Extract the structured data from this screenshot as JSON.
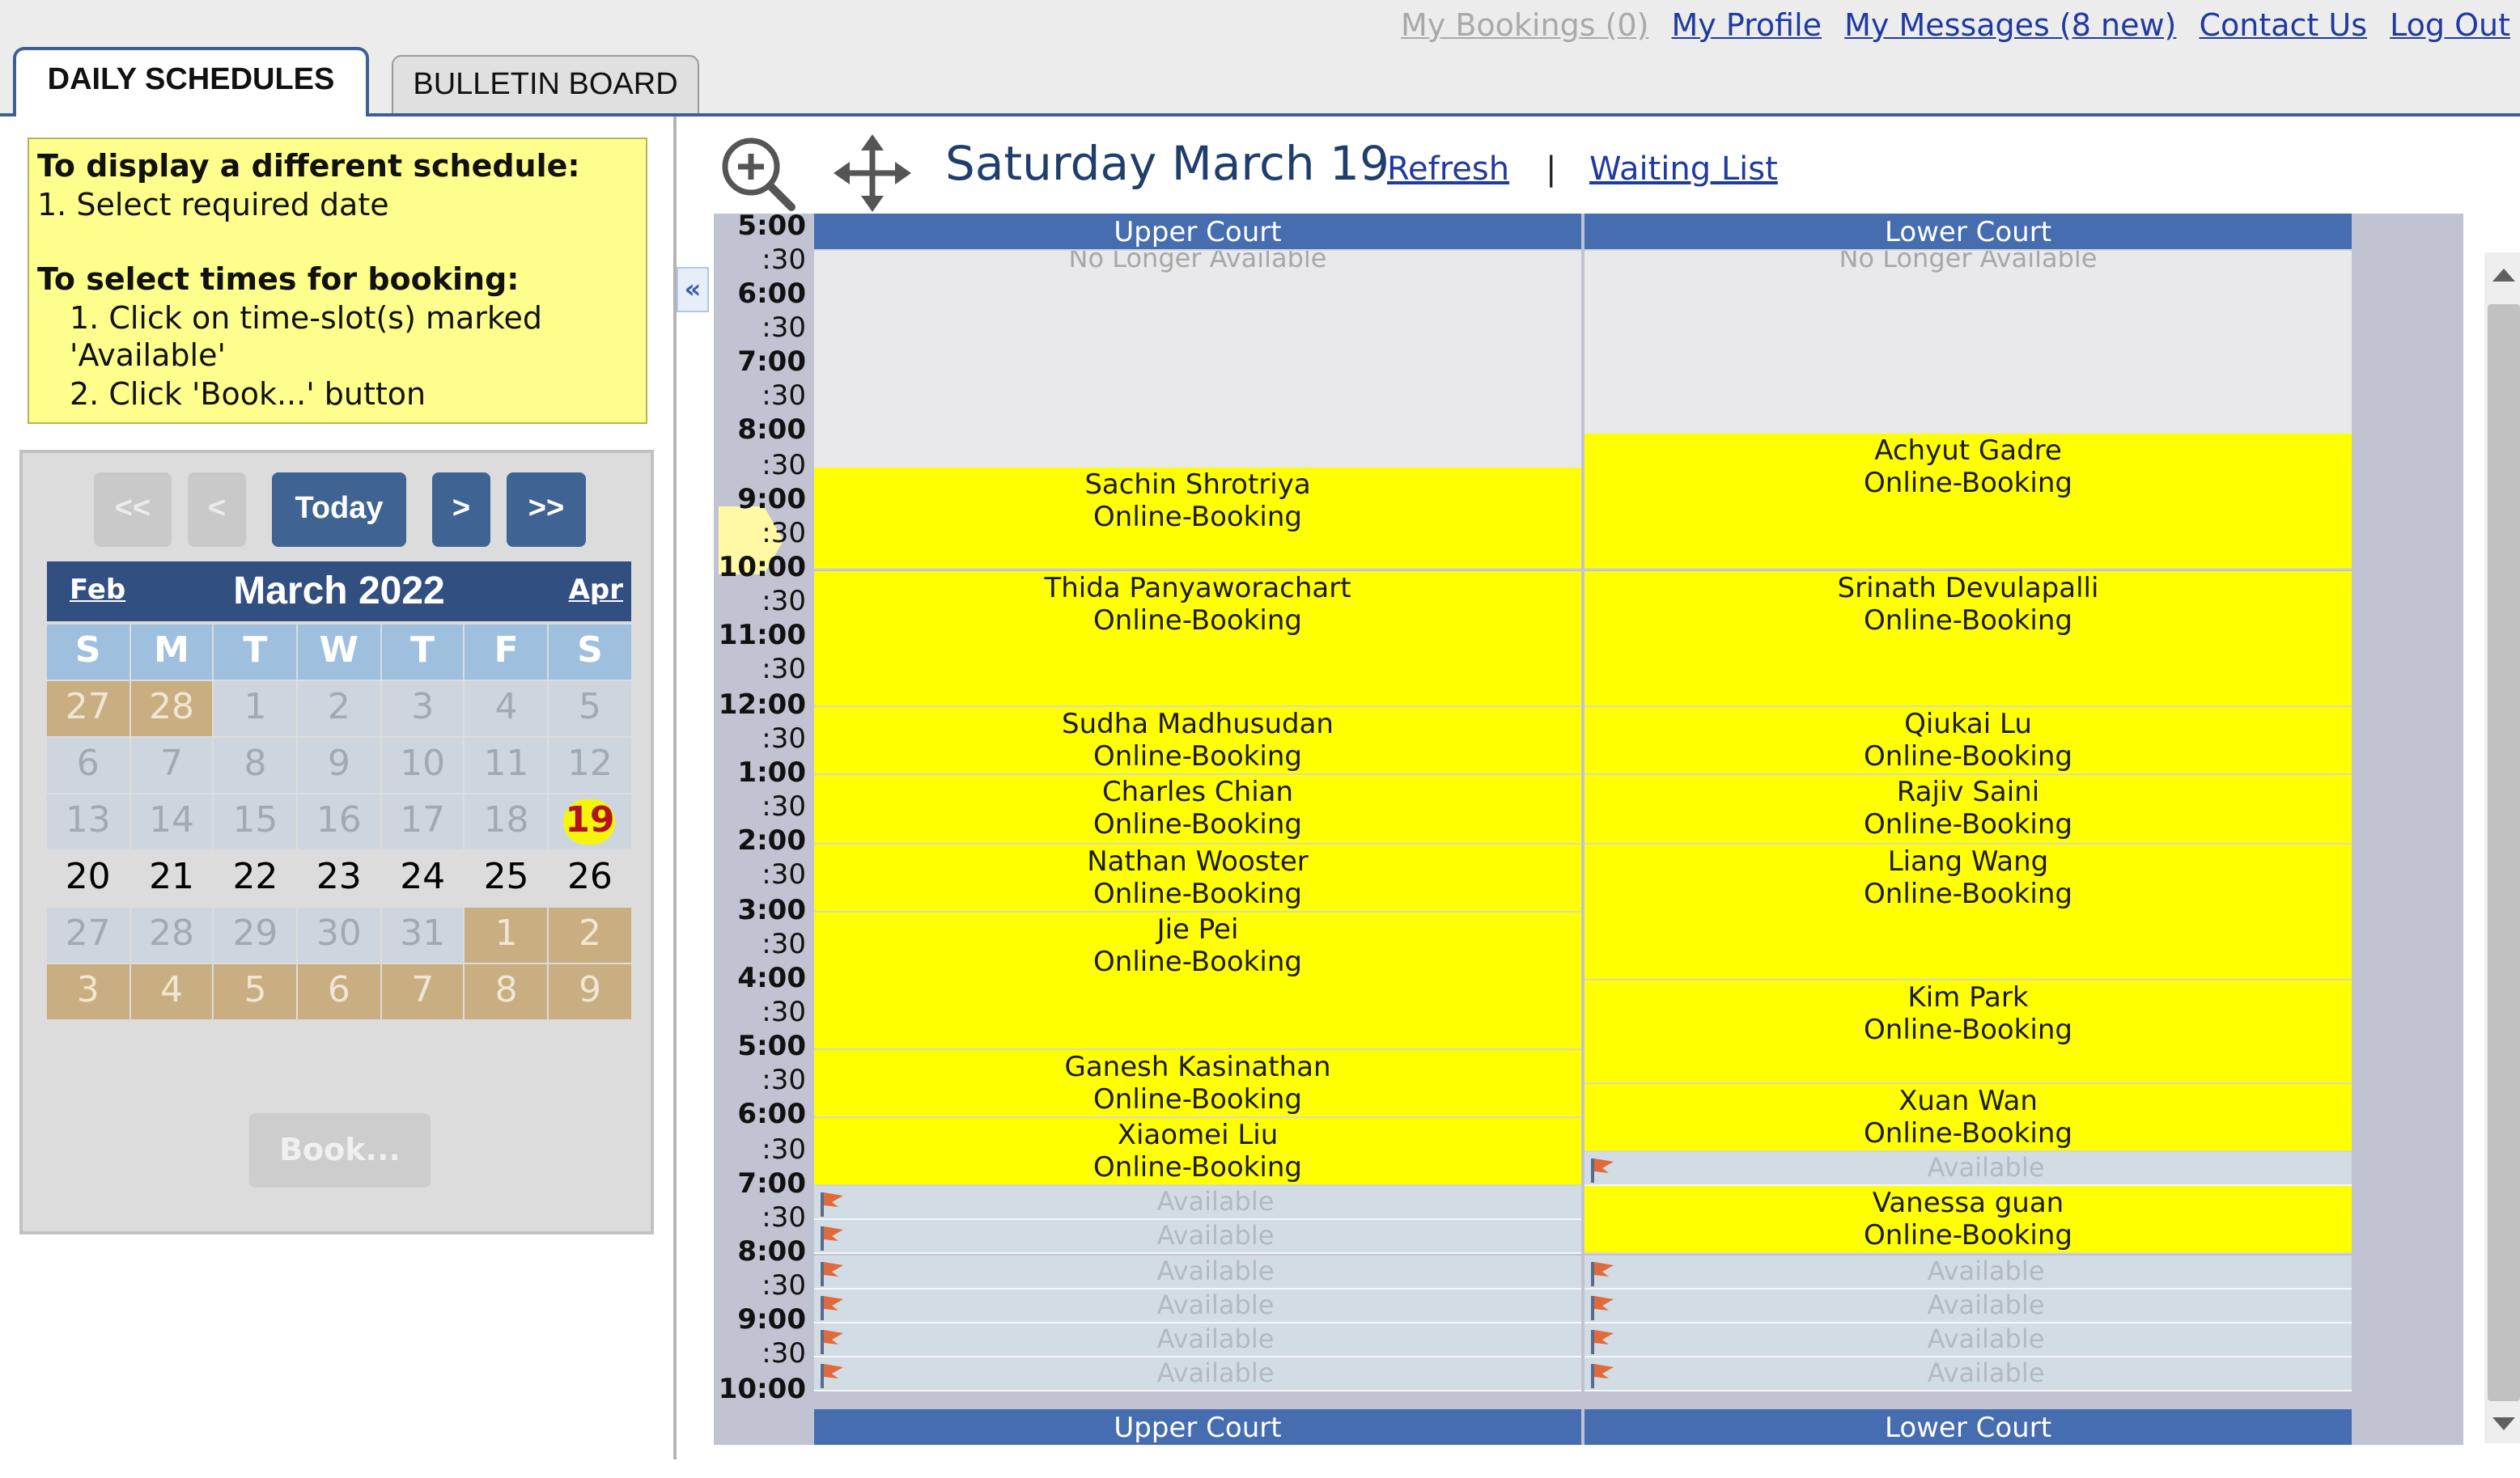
{
  "header": {
    "links": [
      {
        "label": "My Bookings (0)",
        "enabled": false
      },
      {
        "label": "My Profile",
        "enabled": true
      },
      {
        "label": "My Messages (8 new)",
        "enabled": true
      },
      {
        "label": "Contact Us",
        "enabled": true
      },
      {
        "label": "Log Out",
        "enabled": true
      }
    ],
    "tabs": [
      {
        "label": "DAILY SCHEDULES",
        "active": true
      },
      {
        "label": "BULLETIN BOARD",
        "active": false
      }
    ]
  },
  "instructions": {
    "title1": "To display a different schedule:",
    "line1": "1. Select required date",
    "title2": "To select times for booking:",
    "line2": "1. Click on time-slot(s) marked 'Available'",
    "line3": "2. Click 'Book...' button"
  },
  "calendar": {
    "nav": {
      "first": "<<",
      "prev": "<",
      "today": "Today",
      "next": ">",
      "last": ">>"
    },
    "prev_month": "Feb",
    "month_label": "March 2022",
    "next_month": "Apr",
    "weekdays": [
      "S",
      "M",
      "T",
      "W",
      "T",
      "F",
      "S"
    ],
    "weeks": [
      [
        {
          "d": "27",
          "s": "out"
        },
        {
          "d": "28",
          "s": "out"
        },
        {
          "d": "1",
          "s": "past"
        },
        {
          "d": "2",
          "s": "past"
        },
        {
          "d": "3",
          "s": "past"
        },
        {
          "d": "4",
          "s": "past"
        },
        {
          "d": "5",
          "s": "past"
        }
      ],
      [
        {
          "d": "6",
          "s": "past"
        },
        {
          "d": "7",
          "s": "past"
        },
        {
          "d": "8",
          "s": "past"
        },
        {
          "d": "9",
          "s": "past"
        },
        {
          "d": "10",
          "s": "past"
        },
        {
          "d": "11",
          "s": "past"
        },
        {
          "d": "12",
          "s": "past"
        }
      ],
      [
        {
          "d": "13",
          "s": "past"
        },
        {
          "d": "14",
          "s": "past"
        },
        {
          "d": "15",
          "s": "past"
        },
        {
          "d": "16",
          "s": "past"
        },
        {
          "d": "17",
          "s": "past"
        },
        {
          "d": "18",
          "s": "past"
        },
        {
          "d": "19",
          "s": "today"
        }
      ],
      [
        {
          "d": "20",
          "s": "fut"
        },
        {
          "d": "21",
          "s": "fut"
        },
        {
          "d": "22",
          "s": "fut"
        },
        {
          "d": "23",
          "s": "fut"
        },
        {
          "d": "24",
          "s": "fut"
        },
        {
          "d": "25",
          "s": "fut"
        },
        {
          "d": "26",
          "s": "fut"
        }
      ],
      [
        {
          "d": "27",
          "s": "past"
        },
        {
          "d": "28",
          "s": "past"
        },
        {
          "d": "29",
          "s": "past"
        },
        {
          "d": "30",
          "s": "past"
        },
        {
          "d": "31",
          "s": "past"
        },
        {
          "d": "1",
          "s": "out"
        },
        {
          "d": "2",
          "s": "out"
        }
      ],
      [
        {
          "d": "3",
          "s": "out"
        },
        {
          "d": "4",
          "s": "out"
        },
        {
          "d": "5",
          "s": "out"
        },
        {
          "d": "6",
          "s": "out"
        },
        {
          "d": "7",
          "s": "out"
        },
        {
          "d": "8",
          "s": "out"
        },
        {
          "d": "9",
          "s": "out"
        }
      ]
    ],
    "book_label": "Book...",
    "colors": {
      "today_highlight": "#f5f50a",
      "today_text": "#b4121a",
      "nav_enabled": "#3f6494",
      "header": "#324f82"
    }
  },
  "schedule": {
    "day_title": "Saturday March 19",
    "refresh_label": "Refresh",
    "separator": "|",
    "waiting_list_label": "Waiting List",
    "time_labels": [
      "5:00",
      ":30",
      "6:00",
      ":30",
      "7:00",
      ":30",
      "8:00",
      ":30",
      "9:00",
      ":30",
      "10:00",
      ":30",
      "11:00",
      ":30",
      "12:00",
      ":30",
      "1:00",
      ":30",
      "2:00",
      ":30",
      "3:00",
      ":30",
      "4:00",
      ":30",
      "5:00",
      ":30",
      "6:00",
      ":30",
      "7:00",
      ":30",
      "8:00",
      ":30",
      "9:00",
      ":30",
      "10:00"
    ],
    "courts": [
      {
        "name": "Upper Court",
        "slots": [
          {
            "from": 0,
            "to": 7,
            "type": "na",
            "lines": [
              "No Longer Available"
            ]
          },
          {
            "from": 7,
            "to": 10,
            "type": "bk",
            "lines": [
              "Sachin Shrotriya",
              "Online-Booking"
            ]
          },
          {
            "from": 10,
            "to": 14,
            "type": "bk",
            "lines": [
              "Thida Panyaworachart",
              "Online-Booking"
            ]
          },
          {
            "from": 14,
            "to": 16,
            "type": "bk",
            "lines": [
              "Sudha Madhusudan",
              "Online-Booking"
            ]
          },
          {
            "from": 16,
            "to": 18,
            "type": "bk",
            "lines": [
              "Charles Chian",
              "Online-Booking"
            ]
          },
          {
            "from": 18,
            "to": 20,
            "type": "bk",
            "lines": [
              "Nathan Wooster",
              "Online-Booking"
            ]
          },
          {
            "from": 20,
            "to": 24,
            "type": "bk",
            "lines": [
              "Jie Pei",
              "Online-Booking"
            ]
          },
          {
            "from": 24,
            "to": 26,
            "type": "bk",
            "lines": [
              "Ganesh Kasinathan",
              "Online-Booking"
            ]
          },
          {
            "from": 26,
            "to": 28,
            "type": "bk",
            "lines": [
              "Xiaomei Liu",
              "Online-Booking"
            ]
          },
          {
            "from": 28,
            "to": 29,
            "type": "av",
            "lines": [
              "Available"
            ]
          },
          {
            "from": 29,
            "to": 30,
            "type": "av",
            "lines": [
              "Available"
            ]
          },
          {
            "from": 30,
            "to": 31,
            "type": "av",
            "lines": [
              "Available"
            ]
          },
          {
            "from": 31,
            "to": 32,
            "type": "av",
            "lines": [
              "Available"
            ]
          },
          {
            "from": 32,
            "to": 33,
            "type": "av",
            "lines": [
              "Available"
            ]
          },
          {
            "from": 33,
            "to": 34,
            "type": "av",
            "lines": [
              "Available"
            ]
          }
        ]
      },
      {
        "name": "Lower Court",
        "slots": [
          {
            "from": 0,
            "to": 6,
            "type": "na",
            "lines": [
              "No Longer Available"
            ]
          },
          {
            "from": 6,
            "to": 10,
            "type": "bk",
            "lines": [
              "Achyut Gadre",
              "Online-Booking"
            ]
          },
          {
            "from": 10,
            "to": 14,
            "type": "bk",
            "lines": [
              "Srinath Devulapalli",
              "Online-Booking"
            ]
          },
          {
            "from": 14,
            "to": 16,
            "type": "bk",
            "lines": [
              "Qiukai Lu",
              "Online-Booking"
            ]
          },
          {
            "from": 16,
            "to": 18,
            "type": "bk",
            "lines": [
              "Rajiv Saini",
              "Online-Booking"
            ]
          },
          {
            "from": 18,
            "to": 22,
            "type": "bk",
            "lines": [
              "Liang Wang",
              "Online-Booking"
            ]
          },
          {
            "from": 22,
            "to": 25,
            "type": "bk",
            "lines": [
              "Kim Park",
              "Online-Booking"
            ]
          },
          {
            "from": 25,
            "to": 27,
            "type": "bk",
            "lines": [
              "Xuan Wan",
              "Online-Booking"
            ]
          },
          {
            "from": 27,
            "to": 28,
            "type": "av",
            "lines": [
              "Available"
            ]
          },
          {
            "from": 28,
            "to": 30,
            "type": "bk",
            "lines": [
              "Vanessa guan",
              "Online-Booking"
            ]
          },
          {
            "from": 30,
            "to": 31,
            "type": "av",
            "lines": [
              "Available"
            ]
          },
          {
            "from": 31,
            "to": 32,
            "type": "av",
            "lines": [
              "Available"
            ]
          },
          {
            "from": 32,
            "to": 33,
            "type": "av",
            "lines": [
              "Available"
            ]
          },
          {
            "from": 33,
            "to": 34,
            "type": "av",
            "lines": [
              "Available"
            ]
          }
        ]
      }
    ],
    "colors": {
      "booked": "#ffff00",
      "available": "#d2dce5",
      "unavailable": "#e9e9eb",
      "court_header": "#456daf"
    }
  }
}
